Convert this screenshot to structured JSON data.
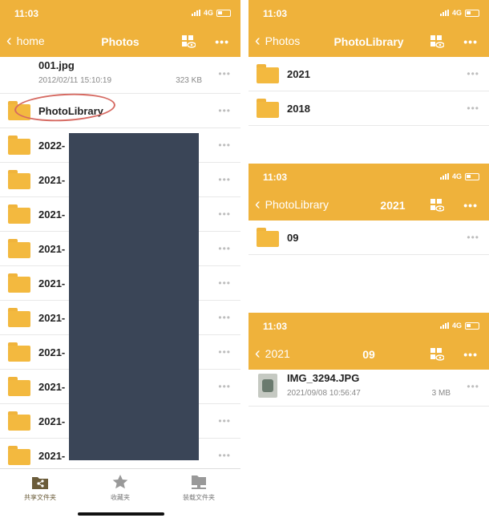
{
  "status": {
    "time": "11:03",
    "network": "4G"
  },
  "left": {
    "back_label": "home",
    "title": "Photos",
    "file": {
      "name": "001.jpg",
      "date": "2012/02/11 15:10:19",
      "size": "323 KB"
    },
    "folders": [
      "PhotoLibrary",
      "2022-",
      "2021-",
      "2021-",
      "2021-",
      "2021-",
      "2021-",
      "2021-",
      "2021-",
      "2021-",
      "2021-"
    ],
    "tabs": [
      {
        "label": "共享文件夹",
        "icon": "shared-folder-icon"
      },
      {
        "label": "收藏夹",
        "icon": "star-icon"
      },
      {
        "label": "装载文件夹",
        "icon": "mounted-folder-icon"
      }
    ]
  },
  "right1": {
    "back_label": "Photos",
    "title": "PhotoLibrary",
    "folders": [
      "2021",
      "2018"
    ]
  },
  "right2": {
    "back_label": "PhotoLibrary",
    "title": "2021",
    "folders": [
      "09"
    ]
  },
  "right3": {
    "back_label": "2021",
    "title": "09",
    "file": {
      "name": "IMG_3294.JPG",
      "date": "2021/09/08 10:56:47",
      "size": "3 MB"
    }
  },
  "colors": {
    "header": "#efb23b",
    "folder": "#f3b93f",
    "redaction": "#3a4557",
    "annotation": "#d66a62"
  }
}
